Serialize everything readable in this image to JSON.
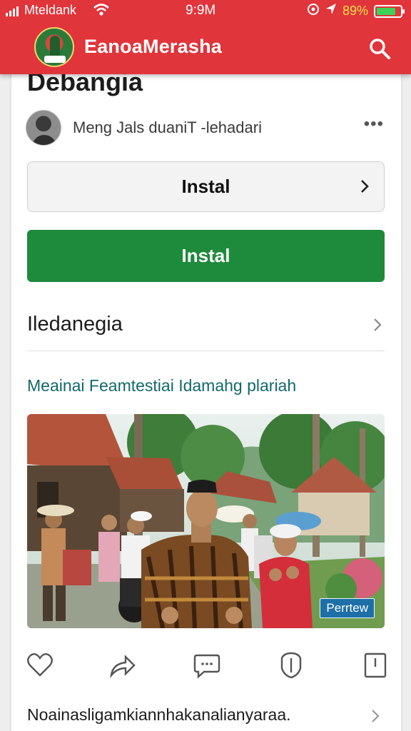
{
  "status_bar": {
    "carrier": "Mteldank",
    "time": "9:9M",
    "battery_percent": "89%",
    "battery_level": 0.8
  },
  "header": {
    "app_title": "EanoaMerasha",
    "logo_icon": "app-logo",
    "search_icon": "search-icon",
    "bar_color": "#e0353b"
  },
  "content": {
    "page_heading": "Debangia",
    "author_line": "Meng Jals duaniT -lehadari",
    "more_icon": "more-dots-icon",
    "install_outline_label": "Instal",
    "install_primary_label": "Instal",
    "primary_color": "#1e8a3c",
    "section_title": "Iledanegia",
    "teal_link": "Meainai Feamtestiai Idamahg plariah",
    "link_color": "#12686b",
    "photo_badge": "Perrtew",
    "bottom_link": "Noainasligamkiannhakanalianyaraa."
  },
  "actions": [
    "heart-icon",
    "share-icon",
    "comment-icon",
    "shield-icon",
    "bookmark-icon"
  ]
}
